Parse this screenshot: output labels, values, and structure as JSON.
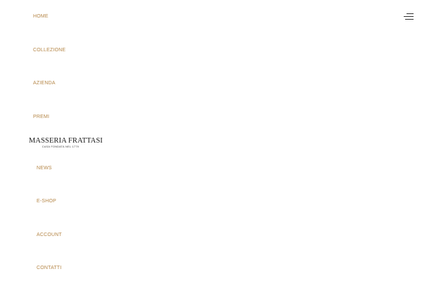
{
  "nav": {
    "home": "HOME",
    "collezione": "COLLEZIONE",
    "azienda": "AZIENDA",
    "premi": "PREMI",
    "news": "NEWS",
    "eshop": "E-SHOP",
    "account": "ACCOUNT",
    "contatti": "CONTATTI"
  },
  "logo": {
    "name": "MASSERIA FRATTASI",
    "tagline": "CASA FONDATA NEL 1779"
  },
  "menu_toggle": {
    "icon": "hamburger-menu-icon"
  },
  "colors": {
    "nav_link": "#b6884a",
    "logo_text": "#1a1a1a",
    "background": "#ffffff"
  }
}
